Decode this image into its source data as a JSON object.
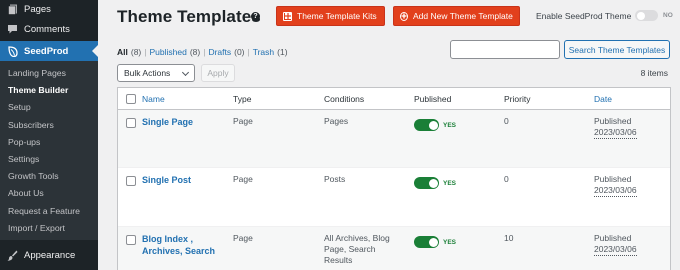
{
  "sidebar": {
    "top_items": [
      {
        "label": "Pages",
        "icon": "pages-icon"
      },
      {
        "label": "Comments",
        "icon": "comment-icon"
      }
    ],
    "seedprod": {
      "label": "SeedProd",
      "icon": "seedprod-leaf-icon"
    },
    "submenu": [
      "Landing Pages",
      "Theme Builder",
      "Setup",
      "Subscribers",
      "Pop-ups",
      "Settings",
      "Growth Tools",
      "About Us",
      "Request a Feature",
      "Import / Export"
    ],
    "current_submenu": "Theme Builder",
    "appearance": {
      "label": "Appearance",
      "icon": "paintbrush-icon"
    }
  },
  "header": {
    "title": "Theme Templates",
    "help_icon": "?",
    "kits_button": "Theme Template Kits",
    "add_button": "Add New Theme Template",
    "enable_label": "Enable SeedProd Theme",
    "enable_state": "NO"
  },
  "filters": {
    "all": {
      "label": "All",
      "count": "(8)"
    },
    "published": {
      "label": "Published",
      "count": "(8)"
    },
    "drafts": {
      "label": "Drafts",
      "count": "(0)"
    },
    "trash": {
      "label": "Trash",
      "count": "(1)"
    },
    "separator": "|"
  },
  "search": {
    "placeholder": "",
    "button": "Search Theme Templates"
  },
  "bulk": {
    "selected": "Bulk Actions",
    "apply": "Apply"
  },
  "items_count": "8 items",
  "table": {
    "columns": {
      "name": "Name",
      "type": "Type",
      "conditions": "Conditions",
      "published": "Published",
      "priority": "Priority",
      "date": "Date"
    },
    "rows": [
      {
        "name": "Single Page",
        "type": "Page",
        "conditions": "Pages",
        "published": true,
        "published_label": "YES",
        "priority": "0",
        "status": "Published",
        "date": "2023/03/06"
      },
      {
        "name": "Single Post",
        "type": "Page",
        "conditions": "Posts",
        "published": true,
        "published_label": "YES",
        "priority": "0",
        "status": "Published",
        "date": "2023/03/06"
      },
      {
        "name": "Blog Index , Archives, Search",
        "type": "Page",
        "conditions": "All Archives, Blog Page, Search Results",
        "published": true,
        "published_label": "YES",
        "priority": "10",
        "status": "Published",
        "date": "2023/03/06"
      }
    ]
  },
  "colors": {
    "sidebar_bg": "#1d2327",
    "sidebar_active": "#2271b1",
    "accent_red": "#e2401c",
    "link_blue": "#2271b1",
    "toggle_on": "#1a7f37"
  }
}
